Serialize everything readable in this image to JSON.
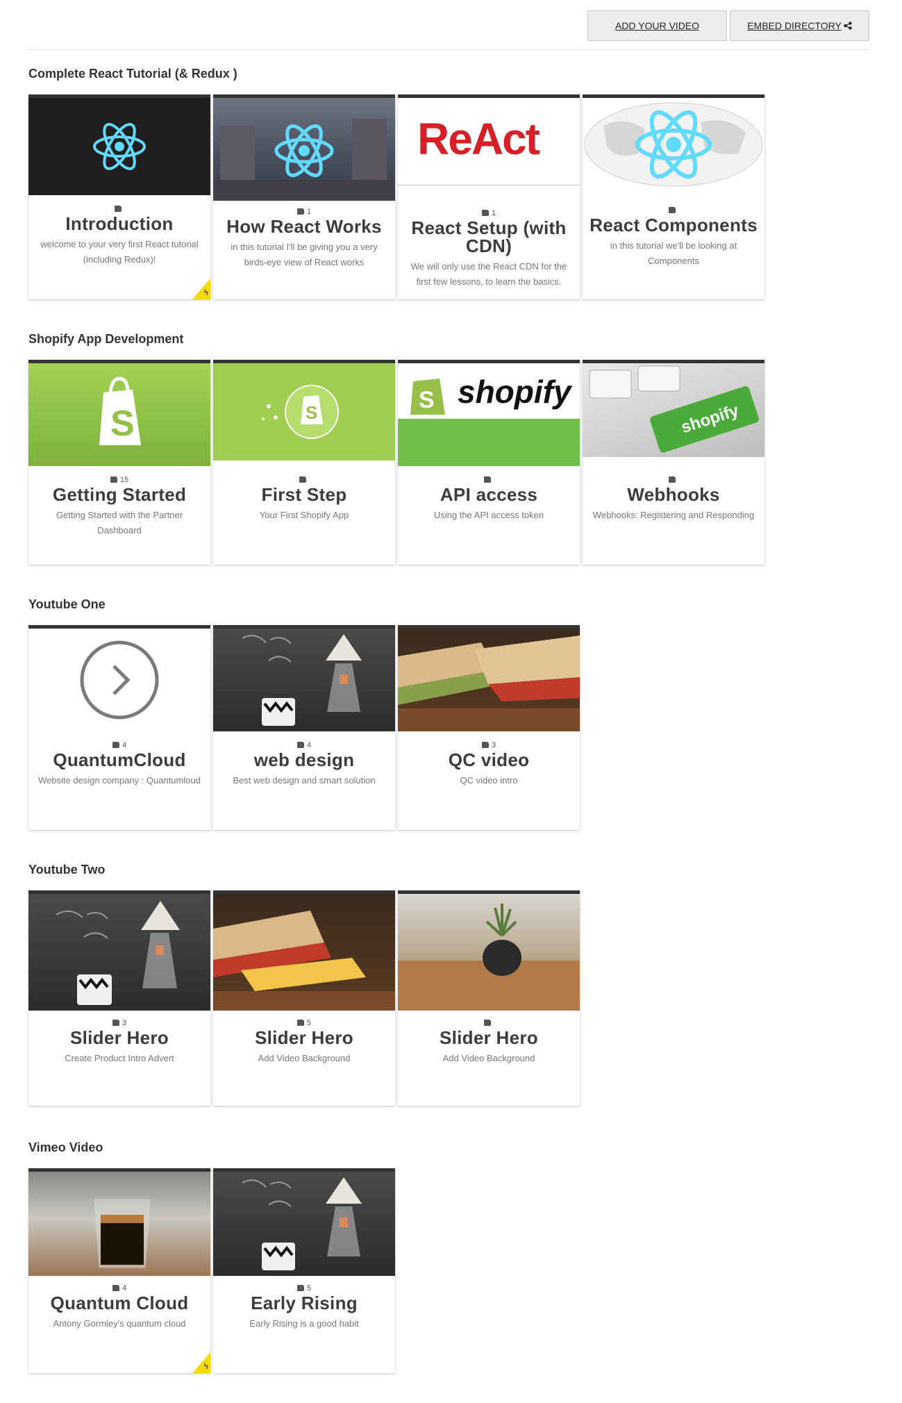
{
  "header": {
    "add_video_label": "ADD YOUR VIDEO",
    "embed_label": "EMBED DIRECTORY",
    "share_icon": "share-icon"
  },
  "sections": [
    {
      "title": "Complete React Tutorial (& Redux )",
      "cards": [
        {
          "title": "Introduction",
          "likes": "",
          "desc": "welcome to your very first React tutorial (including Redux)!"
        },
        {
          "title": "How React Works",
          "likes": "1",
          "desc": "in this tutorial I'll be giving you a very birds-eye view of React works"
        },
        {
          "title": "React Setup (with CDN)",
          "likes": "1",
          "desc": "We will only use the React CDN for the first few lessons, to learn the basics.",
          "logo_text": "ReAct"
        },
        {
          "title": "React Components",
          "likes": "",
          "desc": "in this tutorial we'll be looking at Components"
        }
      ]
    },
    {
      "title": "Shopify App Development",
      "cards": [
        {
          "title": "Getting Started",
          "likes": "15",
          "desc": "Getting Started with the Partner Dashboard"
        },
        {
          "title": "First Step",
          "likes": "",
          "desc": "Your First Shopify App"
        },
        {
          "title": "API access",
          "likes": "",
          "desc": "Using the API access token",
          "logo_text": "shopify"
        },
        {
          "title": "Webhooks",
          "likes": "",
          "desc": "Webhooks: Registering and Responding"
        }
      ]
    },
    {
      "title": "Youtube One",
      "cards": [
        {
          "title": "QuantumCloud",
          "likes": "4",
          "desc": "Website design company : Quantumloud"
        },
        {
          "title": "web design",
          "likes": "4",
          "desc": "Best web design and smart solution"
        },
        {
          "title": "QC video",
          "likes": "3",
          "desc": "QC video intro"
        }
      ]
    },
    {
      "title": "Youtube Two",
      "cards": [
        {
          "title": "Slider Hero",
          "likes": "3",
          "desc": "Create Product Intro Advert"
        },
        {
          "title": "Slider Hero",
          "likes": "5",
          "desc": "Add Video Background"
        },
        {
          "title": "Slider Hero",
          "likes": "",
          "desc": "Add Video Background"
        }
      ]
    },
    {
      "title": "Vimeo Video",
      "cards": [
        {
          "title": "Quantum Cloud",
          "likes": "4",
          "desc": "Antony Gormley's quantum cloud"
        },
        {
          "title": "Early Rising",
          "likes": "5",
          "desc": "Early Rising is a good habit"
        }
      ]
    }
  ],
  "colors": {
    "react": "#61dafb",
    "shopify_green": "#95bf47",
    "card_border": "#333333",
    "featured_badge": "#f5d90a"
  }
}
